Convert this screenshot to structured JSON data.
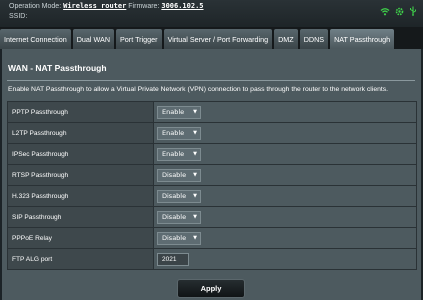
{
  "topbar": {
    "operation_mode_label": "Operation Mode:",
    "operation_mode_value": "Wireless router",
    "firmware_label": "Firmware:",
    "firmware_value": "3006.102.5",
    "ssid_label": "SSID:",
    "icons": [
      "wifi-icon",
      "settings-icon",
      "usb-icon"
    ],
    "icon_color": "#3fd14a"
  },
  "tabs": [
    {
      "label": "Internet Connection",
      "active": false
    },
    {
      "label": "Dual WAN",
      "active": false
    },
    {
      "label": "Port Trigger",
      "active": false
    },
    {
      "label": "Virtual Server / Port Forwarding",
      "active": false
    },
    {
      "label": "DMZ",
      "active": false
    },
    {
      "label": "DDNS",
      "active": false
    },
    {
      "label": "NAT Passthrough",
      "active": true
    }
  ],
  "main": {
    "title": "WAN - NAT Passthrough",
    "description": "Enable NAT Passthrough to allow a Virtual Private Network (VPN) connection to pass through the router to the network clients.",
    "rows": [
      {
        "label": "PPTP Passthrough",
        "value": "Enable"
      },
      {
        "label": "L2TP Passthrough",
        "value": "Enable"
      },
      {
        "label": "IPSec Passthrough",
        "value": "Enable"
      },
      {
        "label": "RTSP Passthrough",
        "value": "Disable"
      },
      {
        "label": "H.323 Passthrough",
        "value": "Disable"
      },
      {
        "label": "SIP Passthrough",
        "value": "Disable"
      },
      {
        "label": "PPPoE Relay",
        "value": "Disable"
      },
      {
        "label": "FTP ALG port",
        "value": "2021"
      }
    ],
    "apply_label": "Apply"
  }
}
